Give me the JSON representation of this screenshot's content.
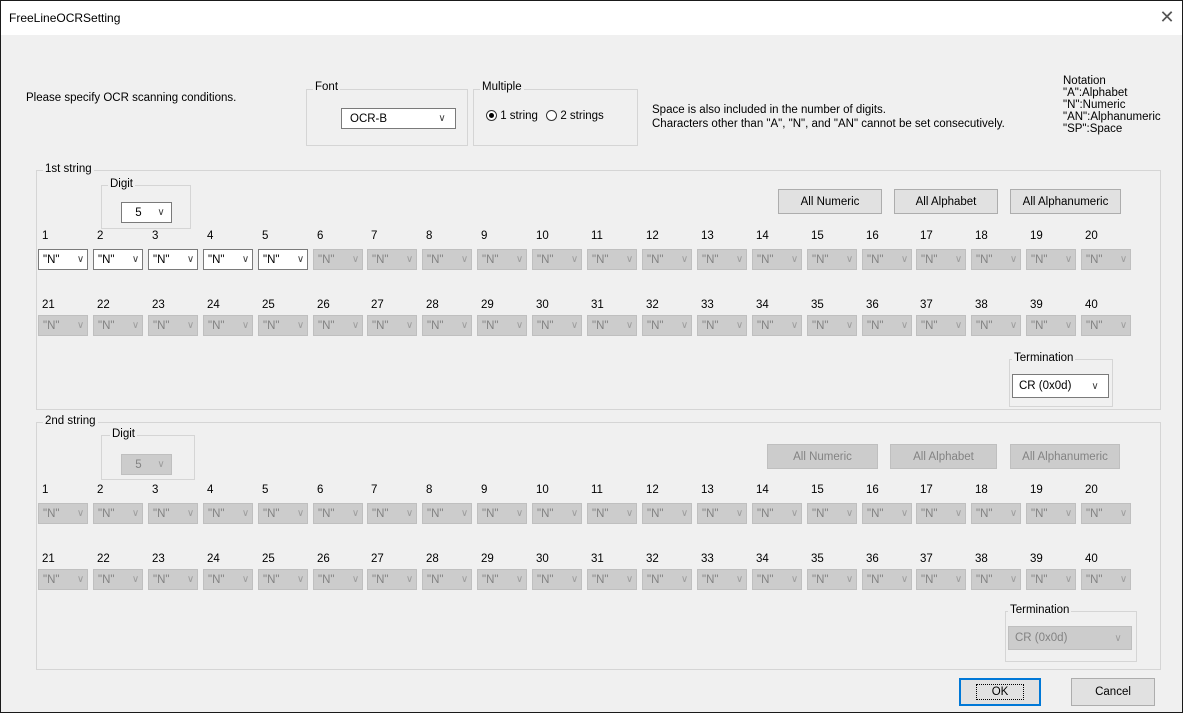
{
  "window": {
    "title": "FreeLineOCRSetting",
    "close_icon": "close-icon"
  },
  "instruction": "Please specify OCR scanning conditions.",
  "font": {
    "legend": "Font",
    "value": "OCR-B"
  },
  "multiple": {
    "legend": "Multiple",
    "option1": "1 string",
    "option2": "2 strings",
    "selected": "1 string"
  },
  "info_lines": [
    "Space is also included in the number of digits.",
    "Characters other than \"A\", \"N\", and \"AN\" cannot be set consecutively."
  ],
  "notation": {
    "title": "Notation",
    "lines": [
      "\"A\":Alphabet",
      "\"N\":Numeric",
      "\"AN\":Alphanumeric",
      "\"SP\":Space"
    ]
  },
  "string1": {
    "legend": "1st string",
    "digit_legend": "Digit",
    "digit_value": "5",
    "buttons": {
      "all_numeric": "All Numeric",
      "all_alphabet": "All Alphabet",
      "all_alphanumeric": "All Alphanumeric"
    },
    "row1_numbers": [
      "1",
      "2",
      "3",
      "4",
      "5",
      "6",
      "7",
      "8",
      "9",
      "10",
      "11",
      "12",
      "13",
      "14",
      "15",
      "16",
      "17",
      "18",
      "19",
      "20"
    ],
    "row2_numbers": [
      "21",
      "22",
      "23",
      "24",
      "25",
      "26",
      "27",
      "28",
      "29",
      "30",
      "31",
      "32",
      "33",
      "34",
      "35",
      "36",
      "37",
      "38",
      "39",
      "40"
    ],
    "combo_value": "\"N\"",
    "enabled_count": 5,
    "termination_legend": "Termination",
    "termination_value": "CR (0x0d)"
  },
  "string2": {
    "legend": "2nd string",
    "digit_legend": "Digit",
    "digit_value": "5",
    "buttons": {
      "all_numeric": "All Numeric",
      "all_alphabet": "All Alphabet",
      "all_alphanumeric": "All Alphanumeric"
    },
    "row1_numbers": [
      "1",
      "2",
      "3",
      "4",
      "5",
      "6",
      "7",
      "8",
      "9",
      "10",
      "11",
      "12",
      "13",
      "14",
      "15",
      "16",
      "17",
      "18",
      "19",
      "20"
    ],
    "row2_numbers": [
      "21",
      "22",
      "23",
      "24",
      "25",
      "26",
      "27",
      "28",
      "29",
      "30",
      "31",
      "32",
      "33",
      "34",
      "35",
      "36",
      "37",
      "38",
      "39",
      "40"
    ],
    "combo_value": "\"N\"",
    "enabled_count": 0,
    "termination_legend": "Termination",
    "termination_value": "CR (0x0d)"
  },
  "footer": {
    "ok": "OK",
    "cancel": "Cancel"
  }
}
